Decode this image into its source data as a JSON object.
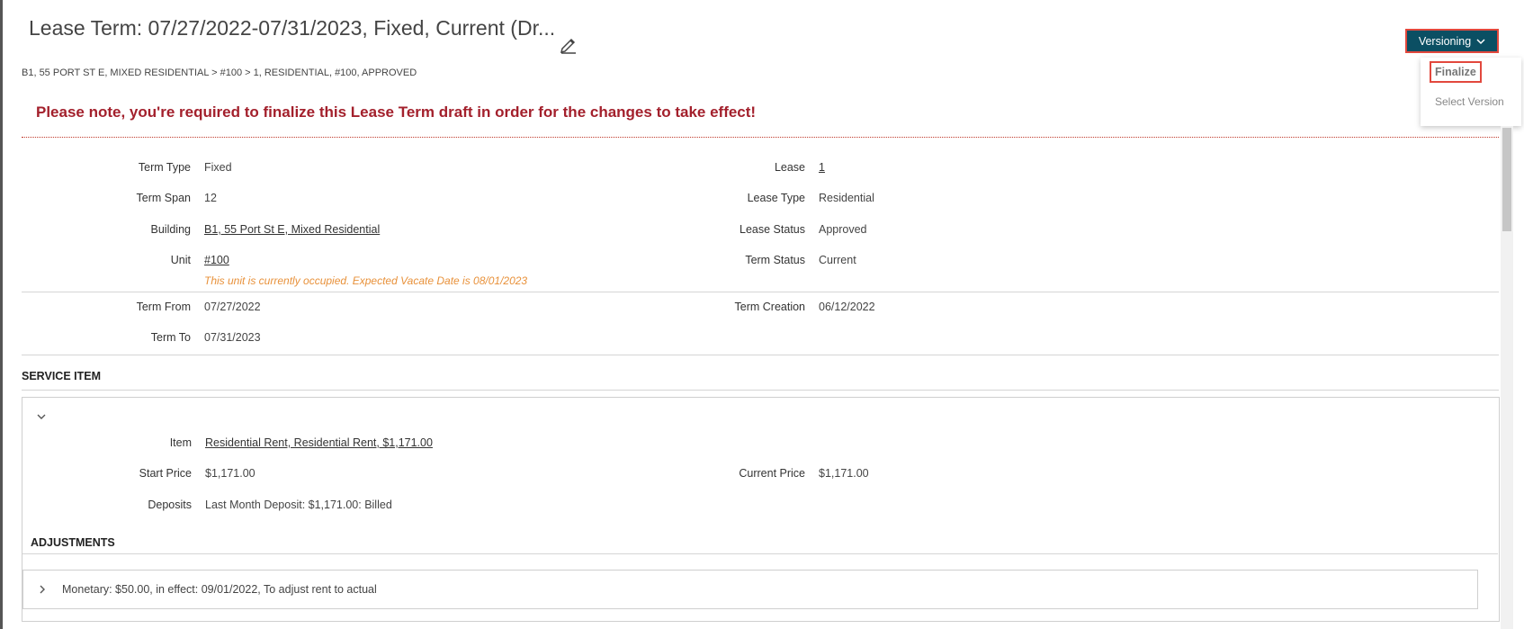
{
  "header": {
    "title": "Lease Term: 07/27/2022-07/31/2023, Fixed, Current (Dr...",
    "breadcrumb": "B1, 55 PORT ST E, MIXED RESIDENTIAL > #100 > 1, RESIDENTIAL, #100, APPROVED",
    "notice": "Please note, you're required to finalize this Lease Term draft in order for the changes to take effect!"
  },
  "versioning": {
    "button_label": "Versioning",
    "menu": {
      "finalize": "Finalize",
      "select_version": "Select Version"
    }
  },
  "details": {
    "term_type": {
      "label": "Term Type",
      "value": "Fixed"
    },
    "term_span": {
      "label": "Term Span",
      "value": "12"
    },
    "building": {
      "label": "Building",
      "value": "B1, 55 Port St E, Mixed Residential"
    },
    "unit": {
      "label": "Unit",
      "value": "#100",
      "warning": "This unit is currently occupied. Expected Vacate Date is 08/01/2023"
    },
    "lease": {
      "label": "Lease",
      "value": "1"
    },
    "lease_type": {
      "label": "Lease Type",
      "value": "Residential"
    },
    "lease_status": {
      "label": "Lease Status",
      "value": "Approved"
    },
    "term_status": {
      "label": "Term Status",
      "value": "Current"
    },
    "term_from": {
      "label": "Term From",
      "value": "07/27/2022"
    },
    "term_to": {
      "label": "Term To",
      "value": "07/31/2023"
    },
    "term_creation": {
      "label": "Term Creation",
      "value": "06/12/2022"
    }
  },
  "service_item": {
    "section_title": "SERVICE ITEM",
    "item": {
      "label": "Item",
      "value": "Residential Rent, Residential Rent, $1,171.00"
    },
    "start_price": {
      "label": "Start Price",
      "value": "$1,171.00"
    },
    "current_price": {
      "label": "Current Price",
      "value": "$1,171.00"
    },
    "deposits": {
      "label": "Deposits",
      "value": "Last Month Deposit: $1,171.00: Billed"
    }
  },
  "adjustments": {
    "section_title": "ADJUSTMENTS",
    "items": [
      "Monetary: $50.00, in effect: 09/01/2022, To adjust rent to actual"
    ]
  },
  "colors": {
    "accent": "#0b4f63",
    "notice": "#a3202c",
    "highlight": "#e2483d",
    "warning": "#e8913a"
  }
}
